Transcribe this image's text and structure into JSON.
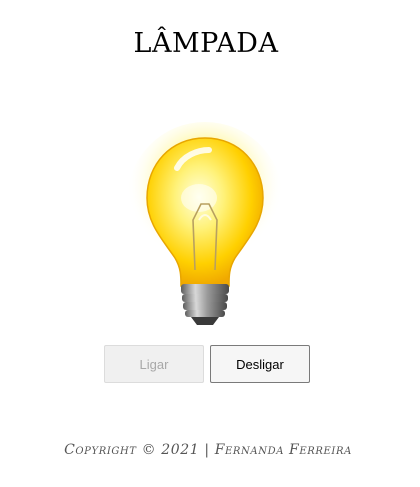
{
  "page": {
    "title": "Lâmpada"
  },
  "bulb": {
    "state": "on",
    "glow_color": "#fff36a",
    "glass_color": "#ffd400",
    "base_color": "#8a8a8a"
  },
  "buttons": {
    "on_label": "Ligar",
    "on_enabled": false,
    "off_label": "Desligar",
    "off_enabled": true
  },
  "footer": {
    "copyright": "Copyright © 2021 | Fernanda Ferreira"
  }
}
